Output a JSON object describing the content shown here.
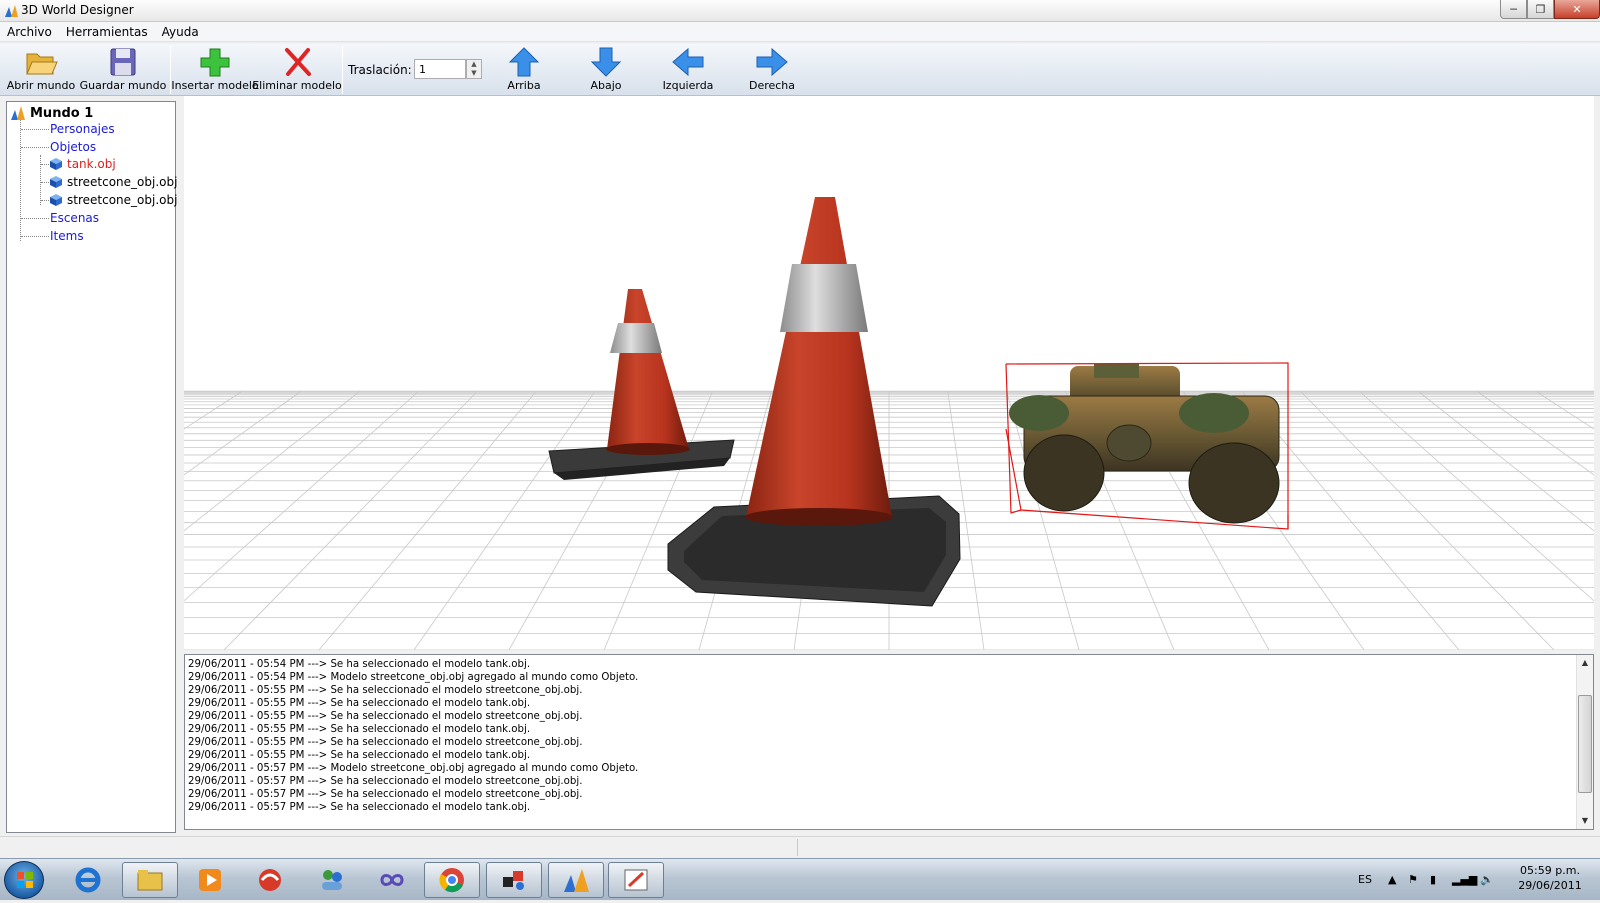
{
  "window": {
    "title": "3D World Designer"
  },
  "menu": [
    "Archivo",
    "Herramientas",
    "Ayuda"
  ],
  "toolbar": {
    "open": "Abrir mundo",
    "save": "Guardar mundo",
    "insert": "Insertar modelo",
    "delete": "Eliminar modelo",
    "translation_label": "Traslación:",
    "translation_value": "1",
    "up": "Arriba",
    "down": "Abajo",
    "left": "Izquierda",
    "right": "Derecha"
  },
  "tree": {
    "root": "Mundo 1",
    "categories": [
      "Personajes",
      "Objetos",
      "Escenas",
      "Items"
    ],
    "objects": [
      "tank.obj",
      "streetcone_obj.obj",
      "streetcone_obj.obj"
    ],
    "selected": "tank.obj"
  },
  "log": [
    "29/06/2011 - 05:54 PM ---> Se ha seleccionado el modelo tank.obj.",
    "29/06/2011 - 05:54 PM ---> Modelo streetcone_obj.obj agregado al mundo como Objeto.",
    "29/06/2011 - 05:55 PM ---> Se ha seleccionado el modelo streetcone_obj.obj.",
    "29/06/2011 - 05:55 PM ---> Se ha seleccionado el modelo tank.obj.",
    "29/06/2011 - 05:55 PM ---> Se ha seleccionado el modelo streetcone_obj.obj.",
    "29/06/2011 - 05:55 PM ---> Se ha seleccionado el modelo tank.obj.",
    "29/06/2011 - 05:55 PM ---> Se ha seleccionado el modelo streetcone_obj.obj.",
    "29/06/2011 - 05:55 PM ---> Se ha seleccionado el modelo tank.obj.",
    "29/06/2011 - 05:57 PM ---> Modelo streetcone_obj.obj agregado al mundo como Objeto.",
    "29/06/2011 - 05:57 PM ---> Se ha seleccionado el modelo streetcone_obj.obj.",
    "29/06/2011 - 05:57 PM ---> Se ha seleccionado el modelo streetcone_obj.obj.",
    "29/06/2011 - 05:57 PM ---> Se ha seleccionado el modelo tank.obj."
  ],
  "taskbar": {
    "language": "ES",
    "time": "05:59 p.m.",
    "date": "29/06/2011"
  },
  "colors": {
    "accent": "#1a1ad8",
    "selected": "#e02020",
    "selection_box": "#e01818",
    "cone": "#b8341e",
    "cone_band": "#c9c9c9",
    "cone_base": "#2f2f2f"
  },
  "icons": {
    "open": "folder-open-icon",
    "save": "floppy-disk-icon",
    "insert": "green-plus-icon",
    "delete": "red-x-icon",
    "up": "arrow-up-icon",
    "down": "arrow-down-icon",
    "left": "arrow-left-icon",
    "right": "arrow-right-icon"
  }
}
